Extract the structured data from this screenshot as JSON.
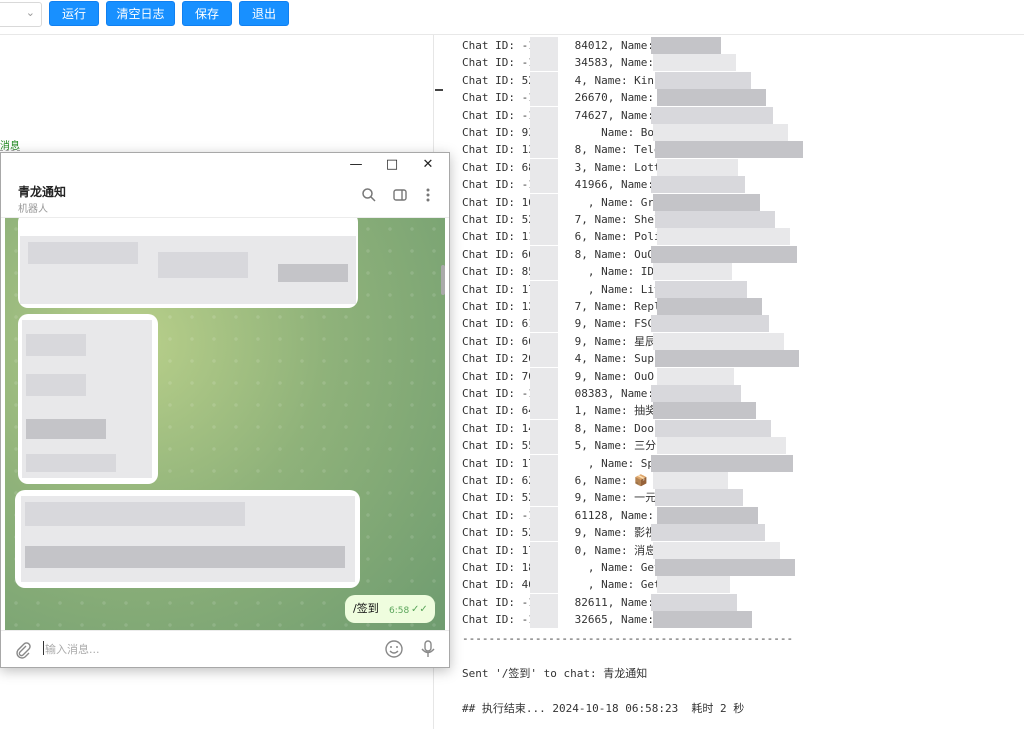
{
  "toolbar": {
    "run_label": "运行",
    "clear_label": "清空日志",
    "save_label": "保存",
    "exit_label": "退出"
  },
  "left_pane": {
    "message_link": "消息"
  },
  "log": {
    "lines": [
      "Chat ID: -100    84012, Name: ",
      "Chat ID: -100    34583, Name: ",
      "Chat ID: 5293    4, Name: Kinh",
      "Chat ID: -100    26670, Name: ",
      "Chat ID: -100    74627, Name: ",
      "Chat ID: 9337        Name: BotFat",
      "Chat ID: 1326    8, Name: Tele",
      "Chat ID: 6849    3, Name: Lott",
      "Chat ID: -100    41966, Name: ",
      "Chat ID: 1627      , Name: Group",
      "Chat ID: 5284    7, Name: Shel",
      "Chat ID: 1148    6, Name: Poli",
      "Chat ID: 6622    8, Name: OuO",
      "Chat ID: 8504      , Name: IDBot",
      "Chat ID: 1794      , Name: Liveg",
      "Chat ID: 1271    7, Name: Repl",
      "Chat ID: 6140    9, Name: FSC",
      "Chat ID: 6611    9, Name: 星辰",
      "Chat ID: 2090    4, Name: Supp",
      "Chat ID: 7087    9, Name: OuO",
      "Chat ID: -100    08383, Name: ",
      "Chat ID: 6420    1, Name: 抽奖",
      "Chat ID: 1446    8, Name: Door",
      "Chat ID: 5599    5, Name: 三分",
      "Chat ID: 1782      , Name: Spam",
      "Chat ID: 6270    6, Name: 📦",
      "Chat ID: 5257    9, Name: 一元",
      "Chat ID: -100    61128, Name: ",
      "Chat ID: 5297    9, Name: 影视",
      "Chat ID: 1745    0, Name: 消息",
      "Chat ID: 1866      , Name: GetID",
      "Chat ID: 4606      , Name: Get M",
      "Chat ID: -100    82611, Name: ",
      "Chat ID: -100    32665, Name: "
    ],
    "separator": "--------------------------------------------------",
    "sent_line": "Sent '/签到' to chat: 青龙通知",
    "end_line": "## 执行结束... 2024-10-18 06:58:23  耗时 2 秒"
  },
  "telegram": {
    "chat_name": "青龙通知",
    "chat_subtitle": "机器人",
    "outgoing_text": "/签到",
    "outgoing_time": "6:58",
    "input_placeholder": "输入消息..."
  }
}
